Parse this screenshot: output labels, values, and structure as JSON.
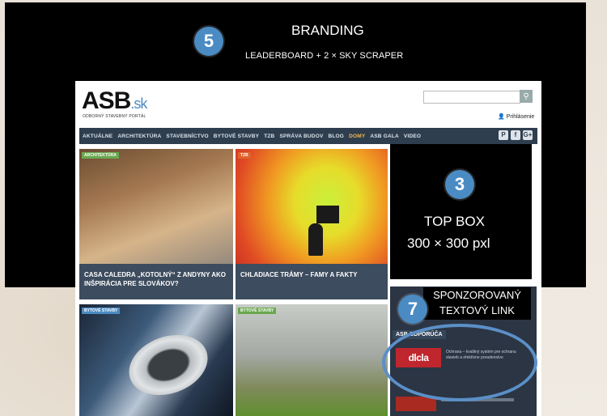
{
  "branding": {
    "badge": "5",
    "title": "BRANDING",
    "subtitle": "LEADERBOARD + 2 × SKY SCRAPER"
  },
  "topbox": {
    "badge": "3",
    "title": "TOP BOX",
    "size": "300 × 300 pxl"
  },
  "sponsored": {
    "badge": "7",
    "line1": "SPONZOROVANÝ",
    "line2": "TEXTOVÝ LINK"
  },
  "site": {
    "logo": "ASB",
    "logo_suffix": ".sk",
    "tagline": "ODBORNÝ STAVEBNÝ PORTÁL",
    "login": "Prihlásenie",
    "nav": [
      "AKTUÁLNE",
      "ARCHITEKTÚRA",
      "STAVEBNÍCTVO",
      "BYTOVÉ STAVBY",
      "TZB",
      "SPRÁVA BUDOV",
      "BLOG",
      "DOMY",
      "ASB GALA",
      "VIDEO"
    ],
    "nav_highlight_index": 7,
    "social": [
      "P",
      "f",
      "G+"
    ],
    "tiles": [
      {
        "category": "ARCHITEKTÚRA",
        "caption": "CASA CALEDRA „KOTOLNÝ“ Z ANDYNY AKO INŠPIRÁCIA PRE SLOVÁKOV?",
        "cat_color": "#6aa84f"
      },
      {
        "category": "TZB",
        "caption": "CHLADIACE TRÁMY – FAMY A FAKTY",
        "cat_color": "#e0622c"
      },
      {
        "category": "BYTOVÉ STAVBY",
        "caption": "",
        "cat_color": "#4b8bc3"
      },
      {
        "category": "BYTOVÉ STAVBY",
        "caption": "",
        "cat_color": "#6aa84f"
      }
    ],
    "sidebar": {
      "label": "ASB ODPORÚČA",
      "promo_logo": "dlcla",
      "promo_text": "Ochrana – kvalitný systém pre ochranu stavieb a efektívne poradenstvo"
    }
  }
}
